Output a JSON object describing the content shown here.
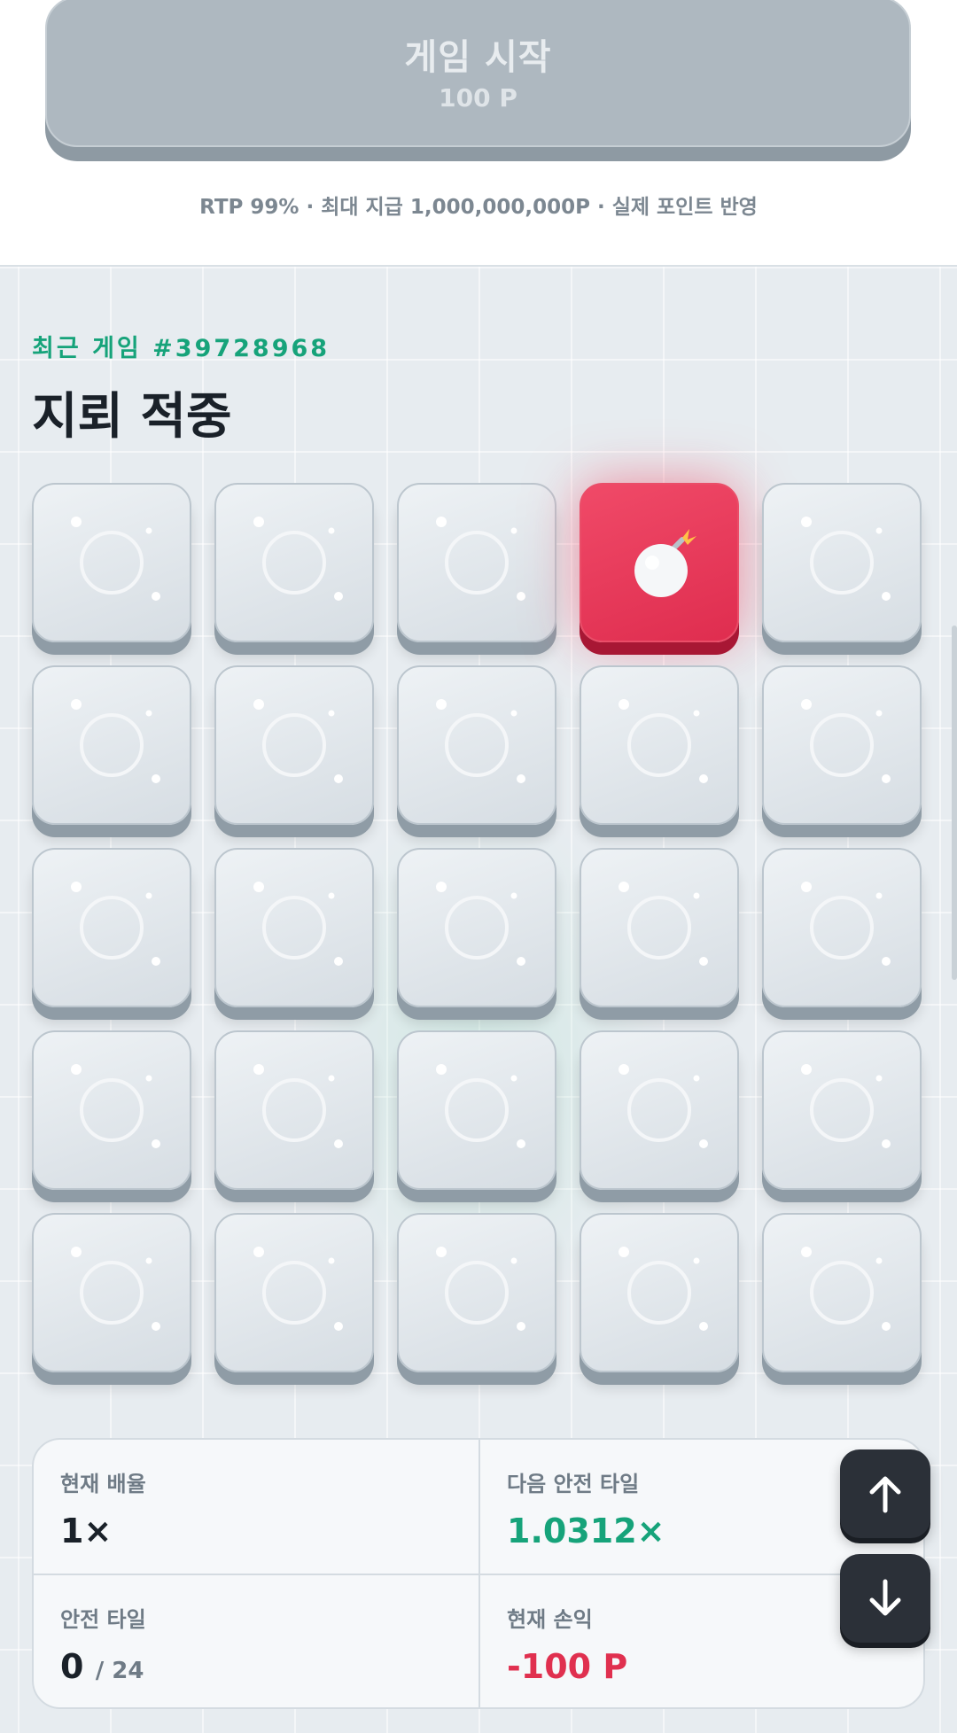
{
  "start_button": {
    "title": "게임 시작",
    "cost": "100 P"
  },
  "info_line": "RTP 99% · 최대 지급 1,000,000,000P · 실제 포인트 반영",
  "game": {
    "recent_label": "최근 게임 #39728968",
    "result_title": "지뢰 적중",
    "rows": 5,
    "cols": 5,
    "tiles": [
      "hidden",
      "hidden",
      "hidden",
      "bomb",
      "hidden",
      "hidden",
      "hidden",
      "hidden",
      "hidden",
      "hidden",
      "hidden",
      "hidden",
      "hidden",
      "hidden",
      "hidden",
      "hidden",
      "hidden",
      "hidden",
      "hidden",
      "hidden",
      "hidden",
      "hidden",
      "hidden",
      "hidden",
      "hidden"
    ]
  },
  "stats": {
    "current_multiplier_label": "현재 배율",
    "current_multiplier_value": "1×",
    "next_safe_label": "다음 안전 타일",
    "next_safe_value": "1.0312×",
    "safe_tiles_label": "안전 타일",
    "safe_tiles_value": "0",
    "safe_tiles_total": "/ 24",
    "current_pnl_label": "현재 손익",
    "current_pnl_value": "-100 P"
  },
  "icons": {
    "tile": "gem-outline-icon",
    "bomb": "bomb-icon",
    "scroll_up": "arrow-up-icon",
    "scroll_down": "arrow-down-icon"
  },
  "colors": {
    "accent_green": "#16a37a",
    "loss_red": "#e0304f",
    "bomb_tile": "#e6375a",
    "start_button_disabled": "#aeb8c0"
  }
}
